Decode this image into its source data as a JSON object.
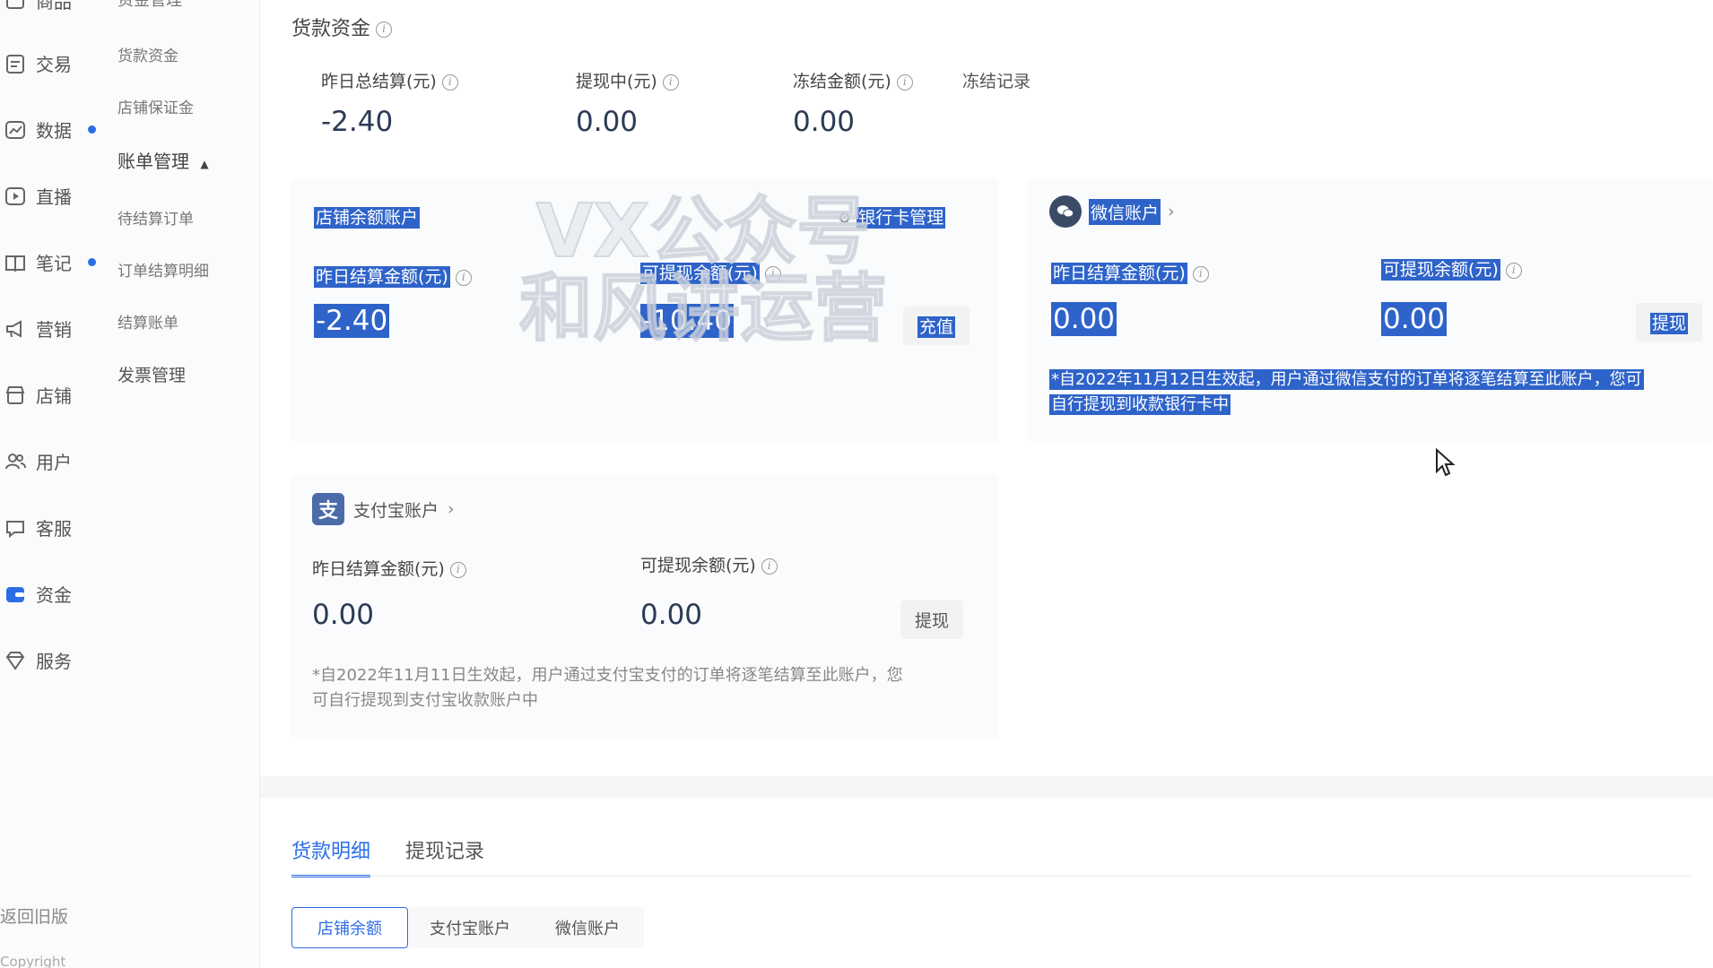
{
  "sidebar": {
    "top_partial": "商品",
    "items": [
      {
        "label": "交易",
        "icon": "clipboard-icon"
      },
      {
        "label": "数据",
        "icon": "chart-icon"
      },
      {
        "label": "直播",
        "icon": "play-icon"
      },
      {
        "label": "笔记",
        "icon": "book-icon"
      },
      {
        "label": "营销",
        "icon": "megaphone-icon"
      },
      {
        "label": "店铺",
        "icon": "store-icon"
      },
      {
        "label": "用户",
        "icon": "users-icon"
      },
      {
        "label": "客服",
        "icon": "chat-icon"
      },
      {
        "label": "资金",
        "icon": "wallet-icon"
      },
      {
        "label": "服务",
        "icon": "diamond-icon"
      }
    ],
    "sub_items": {
      "top_partial": "资金管理",
      "goods_funds": "货款资金",
      "deposit": "店铺保证金",
      "bill_mgmt": "账单管理",
      "pending": "待结算订单",
      "detail": "订单结算明细",
      "bill": "结算账单",
      "invoice": "发票管理"
    },
    "back_old": "返回旧版",
    "copyright": "Copyright"
  },
  "summary": {
    "title": "货款资金",
    "yesterday_total_label": "昨日总结算(元)",
    "yesterday_total_value": "-2.40",
    "withdrawing_label": "提现中(元)",
    "withdrawing_value": "0.00",
    "frozen_label": "冻结金额(元)",
    "frozen_value": "0.00",
    "frozen_record_link": "冻结记录"
  },
  "store_account": {
    "title": "店铺余额账户",
    "bank_mgmt": "银行卡管理",
    "settle_label": "昨日结算金额(元)",
    "settle_value": "-2.40",
    "avail_label": "可提现余额(元)",
    "avail_value": "-10.40",
    "recharge_button": "充值"
  },
  "watermark": {
    "line1": "VX公众号",
    "line2": "和风讲运营"
  },
  "wechat_account": {
    "title": "微信账户",
    "settle_label": "昨日结算金额(元)",
    "settle_value": "0.00",
    "avail_label": "可提现余额(元)",
    "avail_value": "0.00",
    "withdraw_button": "提现",
    "note_line1": "*自2022年11月12日生效起，用户通过微信支付的订单将逐笔结算至此账户，您可",
    "note_line2": "自行提现到收款银行卡中"
  },
  "alipay_account": {
    "title": "支付宝账户",
    "settle_label": "昨日结算金额(元)",
    "settle_value": "0.00",
    "avail_label": "可提现余额(元)",
    "avail_value": "0.00",
    "withdraw_button": "提现",
    "note_line1": "*自2022年11月11日生效起，用户通过支付宝支付的订单将逐笔结算至此账户，您",
    "note_line2": "可自行提现到支付宝收款账户中"
  },
  "tabs": {
    "detail": "货款明细",
    "withdraw": "提现记录"
  },
  "subtabs": {
    "store": "店铺余额",
    "alipay": "支付宝账户",
    "wechat": "微信账户"
  },
  "colors": {
    "accent": "#2c6de6",
    "selection": "#2e63c9"
  }
}
